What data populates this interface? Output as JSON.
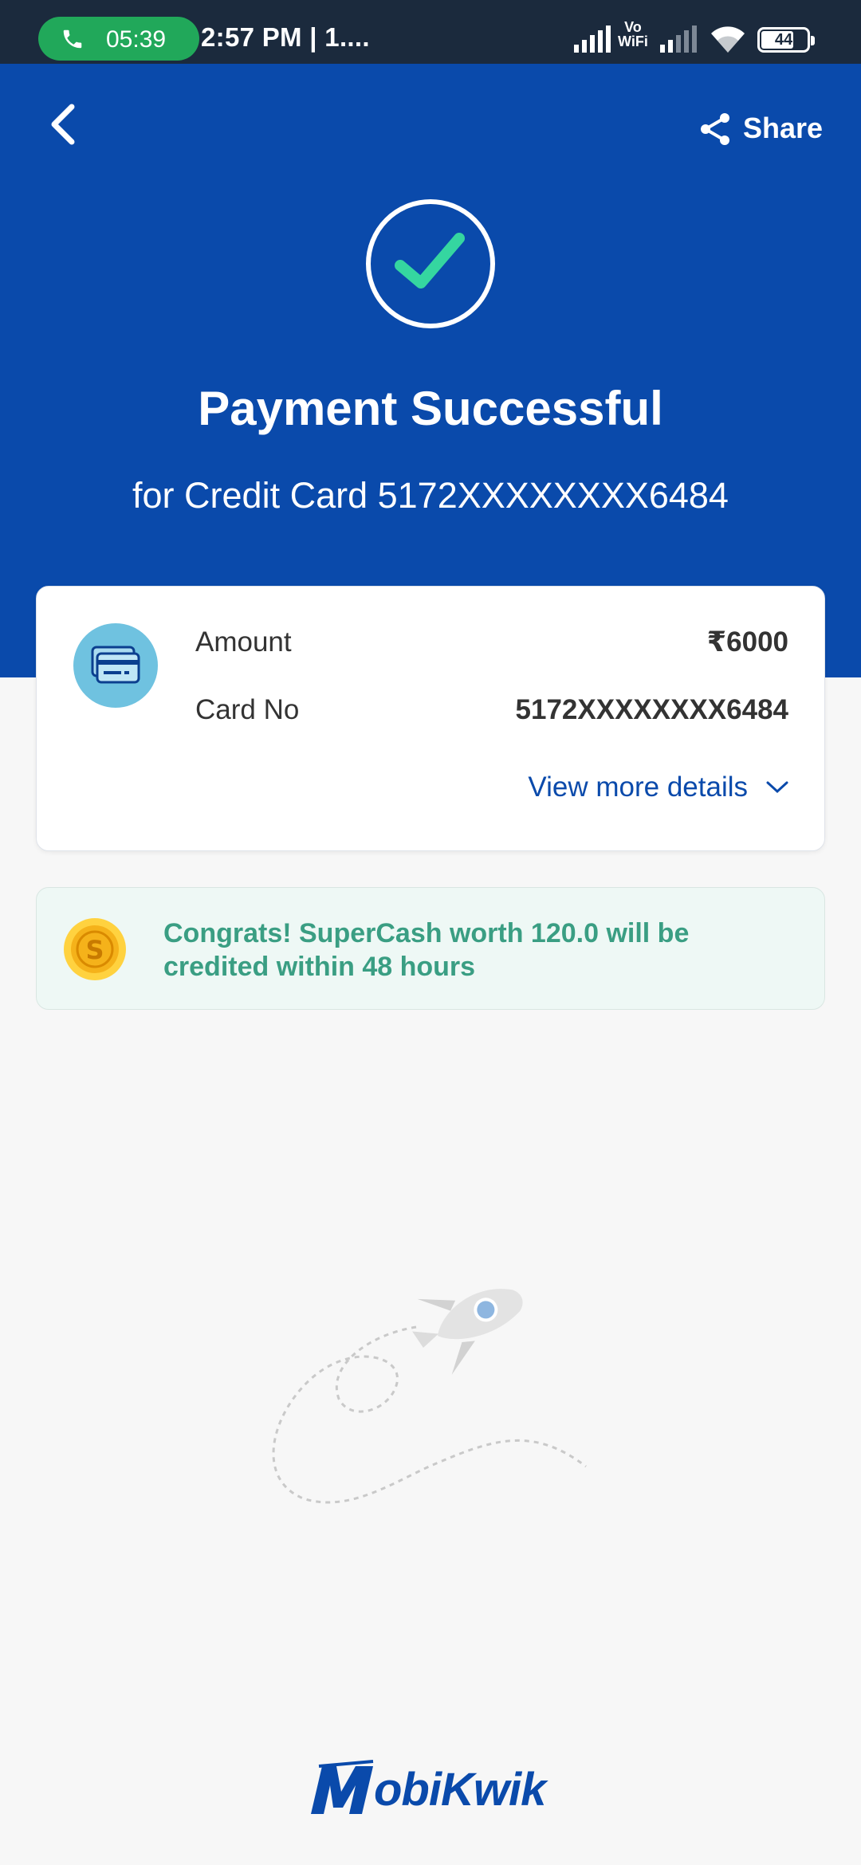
{
  "status_bar": {
    "call_timer": "05:39",
    "time": "2:57 PM | 1....",
    "network_label_top": "Vo",
    "network_label_bottom": "WiFi",
    "battery": "44"
  },
  "header": {
    "share_label": "Share",
    "title": "Payment Successful",
    "subtitle": "for Credit Card 5172XXXXXXXX6484"
  },
  "summary": {
    "amount_label": "Amount",
    "amount_value": "₹6000",
    "card_label": "Card No",
    "card_value": "5172XXXXXXXX6484",
    "view_more": "View more details"
  },
  "promo": {
    "text": "Congrats! SuperCash worth 120.0 will be credited within 48 hours"
  },
  "branding": {
    "logo": "MobiKwik"
  },
  "colors": {
    "primary": "#0a4aab",
    "success_check": "#35d6a0",
    "promo_text": "#3a9e83",
    "promo_bg": "#eef8f5"
  }
}
